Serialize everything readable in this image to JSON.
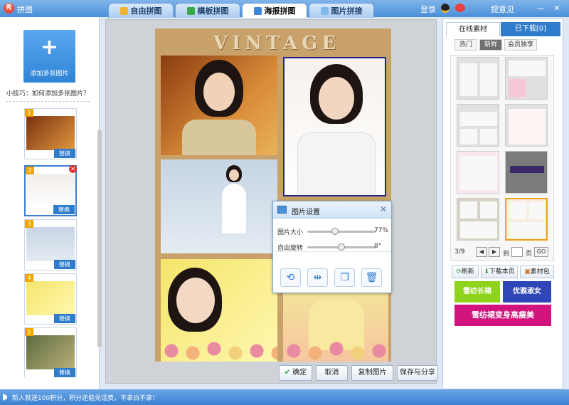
{
  "app": {
    "title": "拼图",
    "logo": "秀"
  },
  "tabs": [
    {
      "label": "自由拼图",
      "icon": "free-collage-icon"
    },
    {
      "label": "模板拼图",
      "icon": "template-collage-icon"
    },
    {
      "label": "海报拼图",
      "icon": "poster-collage-icon"
    },
    {
      "label": "图片拼接",
      "icon": "image-stitch-icon"
    }
  ],
  "header": {
    "login": "登录",
    "feedback": "提意见",
    "minimize": "—",
    "close": "✕"
  },
  "left": {
    "add_button": "添加多张图片",
    "add_symbol": "+",
    "tip": "小技巧：如何添加多张图片？",
    "thumbs": [
      {
        "num": "1",
        "replace": "替换"
      },
      {
        "num": "2",
        "replace": "替换",
        "delete": "✕"
      },
      {
        "num": "3",
        "replace": "替换"
      },
      {
        "num": "4",
        "replace": "替换"
      },
      {
        "num": "5",
        "replace": "替换"
      }
    ]
  },
  "poster": {
    "headline": "VINTAGE"
  },
  "dialog": {
    "title": "图片设置",
    "close": "✕",
    "size_label": "图片大小",
    "size_value": "77%",
    "size_level": 0.4,
    "rotate_label": "自由旋转",
    "rotate_value": "8°",
    "rotate_level": 0.5,
    "tools": [
      "⟲",
      "⇹",
      "❐",
      "🗑"
    ]
  },
  "bottom": {
    "confirm": "确定",
    "cancel": "取消",
    "copy": "复制图片",
    "save": "保存与分享"
  },
  "right": {
    "tab_online": "在线素材",
    "tab_downloaded": "已下载[0]",
    "subtabs": [
      "热门",
      "新鲜",
      "会员独享"
    ],
    "pager": {
      "page": "3/9",
      "prev": "◀",
      "next": "▶",
      "goto_label": "到",
      "page_unit": "页",
      "go": "GO"
    },
    "actions": {
      "refresh": "刷新",
      "download_page": "下载本页",
      "package": "素材包"
    },
    "ads": {
      "ad1": "雪纺长裙",
      "ad2": "优雅淑女",
      "ad3": "雪纺裙变身高瘦美"
    }
  },
  "status": {
    "text": "新人就送100积分，积分还能兑话费，不拿白不拿！"
  },
  "colors": {
    "accent": "#2f7ccc",
    "ad_green": "#8ed31c",
    "ad_blue": "#2f46b8",
    "ad_magenta": "#d1137e"
  }
}
